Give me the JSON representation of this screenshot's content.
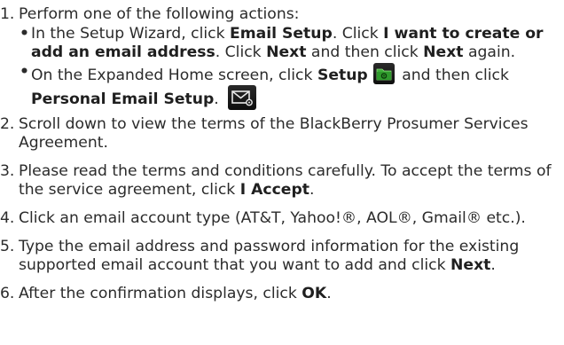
{
  "steps": [
    {
      "num": "1.",
      "text": "Perform one of the following actions:",
      "subitems": [
        {
          "bullet": "•",
          "parts": {
            "t1": "In the Setup Wizard, click ",
            "b1": "Email Setup",
            "t2": ". Click ",
            "b2": "I want to create or add an email address",
            "t3": ". Click ",
            "b3": "Next",
            "t4": " and then click ",
            "b4": "Next",
            "t5": " again."
          }
        },
        {
          "bullet": "•",
          "parts": {
            "t1": "On the Expanded Home screen, click ",
            "b1": "Setup",
            "t2": " and then click ",
            "b2": "Personal Email Setup",
            "t3": "."
          }
        }
      ]
    },
    {
      "num": "2.",
      "text": "Scroll down to view the terms of the BlackBerry Prosumer Services Agreement."
    },
    {
      "num": "3.",
      "text": "Please read the terms and conditions carefully. To accept the terms of the service agreement, click ",
      "bold": "I Accept",
      "end": "."
    },
    {
      "num": "4.",
      "text": "Click an email account type (AT&T, Yahoo!®, AOL®, Gmail® etc.)."
    },
    {
      "num": "5.",
      "text": "Type the email address and password information for the existing supported email account that you want to add and click ",
      "bold": "Next",
      "end": "."
    },
    {
      "num": "6.",
      "text": "After the confirmation displays, click ",
      "bold": "OK",
      "end": "."
    }
  ],
  "icons": {
    "setup": "setup-folder-icon",
    "mail": "personal-email-setup-icon",
    "accent": "#5ac24a"
  }
}
